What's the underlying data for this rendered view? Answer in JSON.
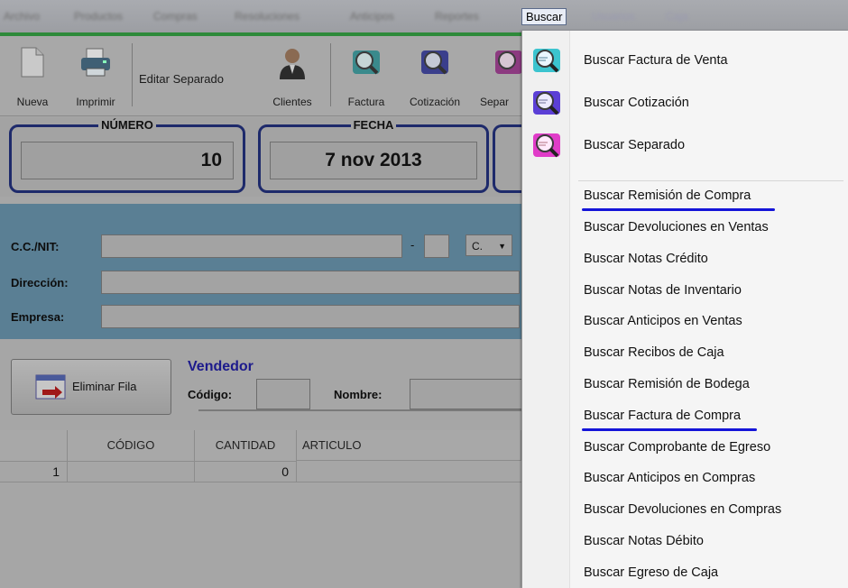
{
  "menubar": {
    "items": [
      "Archivo",
      "Productos",
      "Compras",
      "Resoluciones",
      "Anticipos",
      "Reportes"
    ],
    "active": "Buscar",
    "after": [
      "Usuarios",
      "Caja"
    ]
  },
  "toolbar": {
    "nueva": "Nueva",
    "imprimir": "Imprimir",
    "editar_separado": "Editar Separado",
    "clientes": "Clientes",
    "factura": "Factura",
    "cotizacion": "Cotización",
    "separado": "Separ"
  },
  "panels": {
    "numero_title": "NÚMERO",
    "numero_value": "10",
    "fecha_title": "FECHA",
    "fecha_value": "7 nov 2013"
  },
  "client": {
    "ccnit_label": "C.C./NIT:",
    "dash": "-",
    "type_value": "C.",
    "direccion_label": "Dirección:",
    "empresa_label": "Empresa:"
  },
  "vendedor": {
    "delete_button": "Eliminar Fila",
    "title": "Vendedor",
    "codigo_label": "Código:",
    "nombre_label": "Nombre:"
  },
  "grid": {
    "headers": [
      "CÓDIGO",
      "CANTIDAD",
      "ARTICULO"
    ],
    "row": {
      "num": "1",
      "cantidad": "0"
    }
  },
  "dropdown": {
    "icon_items": [
      {
        "label": "Buscar Factura de Venta",
        "icon": "search-invoice-cyan-icon"
      },
      {
        "label": "Buscar Cotización",
        "icon": "search-quote-purple-icon"
      },
      {
        "label": "Buscar Separado",
        "icon": "search-layaway-pink-icon"
      }
    ],
    "items": [
      "Buscar Remisión de Compra",
      "Buscar Devoluciones en Ventas",
      "Buscar Notas Crédito",
      "Buscar Notas de Inventario",
      "Buscar Anticipos en Ventas",
      "Buscar Recibos de Caja",
      "Buscar Remisión de Bodega",
      "Buscar Factura de Compra",
      "Buscar Comprobante de Egreso",
      "Buscar Anticipos en Compras",
      "Buscar Devoluciones en Compras",
      "Buscar Notas Débito",
      "Buscar Egreso de Caja"
    ],
    "highlight_color": "#1414d8"
  }
}
